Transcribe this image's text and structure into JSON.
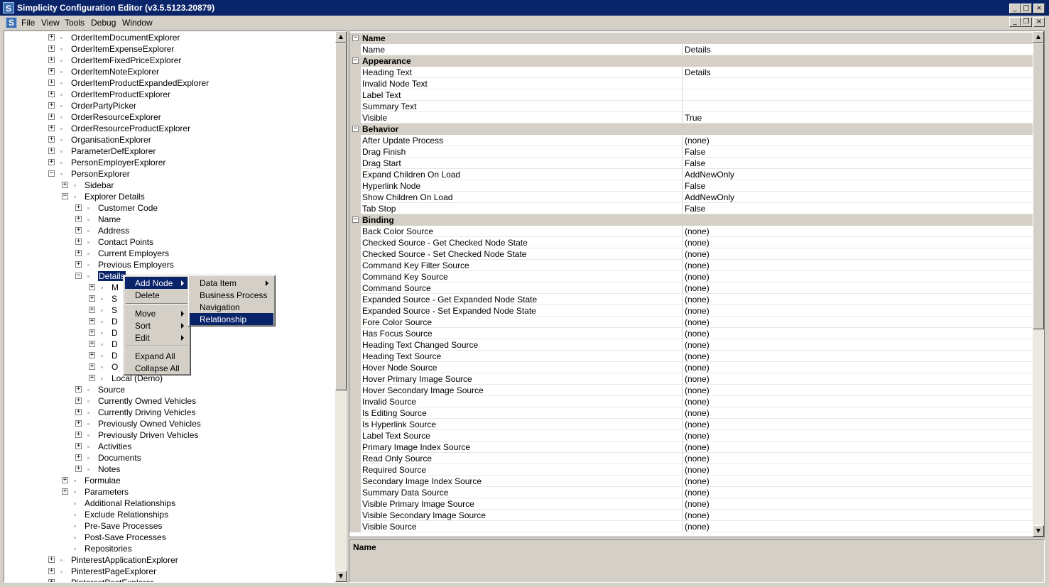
{
  "window": {
    "title": "Simplicity Configuration Editor (v3.5.5123.20879)",
    "app_icon_letter": "S",
    "buttons": {
      "minimize": "_",
      "maximize": "□",
      "close": "×"
    }
  },
  "menubar": {
    "items": [
      "File",
      "View",
      "Tools",
      "Debug",
      "Window"
    ]
  },
  "mdi_buttons": {
    "minimize": "_",
    "restore": "❐",
    "close": "×"
  },
  "tree": {
    "rows": [
      {
        "label": "OrderItemDocumentExplorer",
        "level": 0,
        "exp": "+"
      },
      {
        "label": "OrderItemExpenseExplorer",
        "level": 0,
        "exp": "+"
      },
      {
        "label": "OrderItemFixedPriceExplorer",
        "level": 0,
        "exp": "+"
      },
      {
        "label": "OrderItemNoteExplorer",
        "level": 0,
        "exp": "+"
      },
      {
        "label": "OrderItemProductExpandedExplorer",
        "level": 0,
        "exp": "+"
      },
      {
        "label": "OrderItemProductExplorer",
        "level": 0,
        "exp": "+"
      },
      {
        "label": "OrderPartyPicker",
        "level": 0,
        "exp": "+"
      },
      {
        "label": "OrderResourceExplorer",
        "level": 0,
        "exp": "+"
      },
      {
        "label": "OrderResourceProductExplorer",
        "level": 0,
        "exp": "+"
      },
      {
        "label": "OrganisationExplorer",
        "level": 0,
        "exp": "+"
      },
      {
        "label": "ParameterDefExplorer",
        "level": 0,
        "exp": "+"
      },
      {
        "label": "PersonEmployerExplorer",
        "level": 0,
        "exp": "+"
      },
      {
        "label": "PersonExplorer",
        "level": 0,
        "exp": "-"
      },
      {
        "label": "Sidebar",
        "level": 1,
        "exp": "+"
      },
      {
        "label": "Explorer Details",
        "level": 1,
        "exp": "-"
      },
      {
        "label": "Customer Code",
        "level": 2,
        "exp": "+"
      },
      {
        "label": "Name",
        "level": 2,
        "exp": "+"
      },
      {
        "label": "Address",
        "level": 2,
        "exp": "+"
      },
      {
        "label": "Contact Points",
        "level": 2,
        "exp": "+"
      },
      {
        "label": "Current Employers",
        "level": 2,
        "exp": "+"
      },
      {
        "label": "Previous Employers",
        "level": 2,
        "exp": "+"
      },
      {
        "label": "Details",
        "level": 2,
        "exp": "-",
        "selected": true
      },
      {
        "label": "M",
        "level": 3,
        "exp": "+"
      },
      {
        "label": "S",
        "level": 3,
        "exp": "+"
      },
      {
        "label": "S",
        "level": 3,
        "exp": "+"
      },
      {
        "label": "D",
        "level": 3,
        "exp": "+"
      },
      {
        "label": "D",
        "level": 3,
        "exp": "+"
      },
      {
        "label": "D",
        "level": 3,
        "exp": "+"
      },
      {
        "label": "D",
        "level": 3,
        "exp": "+"
      },
      {
        "label": "O",
        "level": 3,
        "exp": "+"
      },
      {
        "label": "Local (Demo)",
        "level": 3,
        "exp": "+"
      },
      {
        "label": "Source",
        "level": 2,
        "exp": "+"
      },
      {
        "label": "Currently Owned Vehicles",
        "level": 2,
        "exp": "+"
      },
      {
        "label": "Currently Driving Vehicles",
        "level": 2,
        "exp": "+"
      },
      {
        "label": "Previously Owned Vehicles",
        "level": 2,
        "exp": "+"
      },
      {
        "label": "Previously Driven Vehicles",
        "level": 2,
        "exp": "+"
      },
      {
        "label": "Activities",
        "level": 2,
        "exp": "+"
      },
      {
        "label": "Documents",
        "level": 2,
        "exp": "+"
      },
      {
        "label": "Notes",
        "level": 2,
        "exp": "+"
      },
      {
        "label": "Formulae",
        "level": 1,
        "exp": "+"
      },
      {
        "label": "Parameters",
        "level": 1,
        "exp": "+"
      },
      {
        "label": "Additional Relationships",
        "level": 1,
        "exp": ""
      },
      {
        "label": "Exclude Relationships",
        "level": 1,
        "exp": ""
      },
      {
        "label": "Pre-Save Processes",
        "level": 1,
        "exp": ""
      },
      {
        "label": "Post-Save Processes",
        "level": 1,
        "exp": ""
      },
      {
        "label": "Repositories",
        "level": 1,
        "exp": ""
      },
      {
        "label": "PinterestApplicationExplorer",
        "level": 0,
        "exp": "+"
      },
      {
        "label": "PinterestPageExplorer",
        "level": 0,
        "exp": "+"
      },
      {
        "label": "PinterestPostExplorer",
        "level": 0,
        "exp": "+"
      }
    ]
  },
  "properties": [
    {
      "category": "Name",
      "items": [
        {
          "name": "Name",
          "value": "Details"
        }
      ]
    },
    {
      "category": "Appearance",
      "items": [
        {
          "name": "Heading Text",
          "value": "Details"
        },
        {
          "name": "Invalid Node Text",
          "value": ""
        },
        {
          "name": "Label Text",
          "value": ""
        },
        {
          "name": "Summary Text",
          "value": ""
        },
        {
          "name": "Visible",
          "value": "True"
        }
      ]
    },
    {
      "category": "Behavior",
      "items": [
        {
          "name": "After Update Process",
          "value": "(none)"
        },
        {
          "name": "Drag Finish",
          "value": "False"
        },
        {
          "name": "Drag Start",
          "value": "False"
        },
        {
          "name": "Expand Children On Load",
          "value": "AddNewOnly"
        },
        {
          "name": "Hyperlink Node",
          "value": "False"
        },
        {
          "name": "Show Children On Load",
          "value": "AddNewOnly"
        },
        {
          "name": "Tab Stop",
          "value": "False"
        }
      ]
    },
    {
      "category": "Binding",
      "items": [
        {
          "name": "Back Color Source",
          "value": "(none)"
        },
        {
          "name": "Checked Source - Get Checked Node State",
          "value": "(none)"
        },
        {
          "name": "Checked Source - Set Checked Node State",
          "value": "(none)"
        },
        {
          "name": "Command Key Filter Source",
          "value": "(none)"
        },
        {
          "name": "Command Key Source",
          "value": "(none)"
        },
        {
          "name": "Command Source",
          "value": "(none)"
        },
        {
          "name": "Expanded Source - Get Expanded Node State",
          "value": "(none)"
        },
        {
          "name": "Expanded Source - Set Expanded Node State",
          "value": "(none)"
        },
        {
          "name": "Fore Color Source",
          "value": "(none)"
        },
        {
          "name": "Has Focus Source",
          "value": "(none)"
        },
        {
          "name": "Heading Text Changed Source",
          "value": "(none)"
        },
        {
          "name": "Heading Text Source",
          "value": "(none)"
        },
        {
          "name": "Hover Node Source",
          "value": "(none)"
        },
        {
          "name": "Hover Primary Image Source",
          "value": "(none)"
        },
        {
          "name": "Hover Secondary Image Source",
          "value": "(none)"
        },
        {
          "name": "Invalid Source",
          "value": "(none)"
        },
        {
          "name": "Is Editing Source",
          "value": "(none)"
        },
        {
          "name": "Is Hyperlink Source",
          "value": "(none)"
        },
        {
          "name": "Label Text Source",
          "value": "(none)"
        },
        {
          "name": "Primary Image Index Source",
          "value": "(none)"
        },
        {
          "name": "Read Only Source",
          "value": "(none)"
        },
        {
          "name": "Required Source",
          "value": "(none)"
        },
        {
          "name": "Secondary Image Index Source",
          "value": "(none)"
        },
        {
          "name": "Summary Data Source",
          "value": "(none)"
        },
        {
          "name": "Visible Primary Image Source",
          "value": "(none)"
        },
        {
          "name": "Visible Secondary Image Source",
          "value": "(none)"
        },
        {
          "name": "Visible Source",
          "value": "(none)"
        }
      ]
    }
  ],
  "description": {
    "title": "Name"
  },
  "context_menu": {
    "items": [
      {
        "label": "Add Node",
        "submenu": true,
        "highlight": true
      },
      {
        "label": "Delete",
        "submenu": false
      },
      {
        "separator": true
      },
      {
        "label": "Move",
        "submenu": true
      },
      {
        "label": "Sort",
        "submenu": true
      },
      {
        "label": "Edit",
        "submenu": true
      },
      {
        "separator": true
      },
      {
        "label": "Expand All",
        "submenu": false
      },
      {
        "label": "Collapse All",
        "submenu": false
      }
    ]
  },
  "add_node_submenu": {
    "items": [
      {
        "label": "Data Item",
        "submenu": true
      },
      {
        "label": "Business Process",
        "submenu": false
      },
      {
        "label": "Navigation",
        "submenu": false
      },
      {
        "label": "Relationship",
        "submenu": false,
        "highlight": true
      }
    ]
  },
  "colors": {
    "titlebar": "#0a246a",
    "chrome": "#d4d0c8",
    "highlight": "#0a246a"
  }
}
